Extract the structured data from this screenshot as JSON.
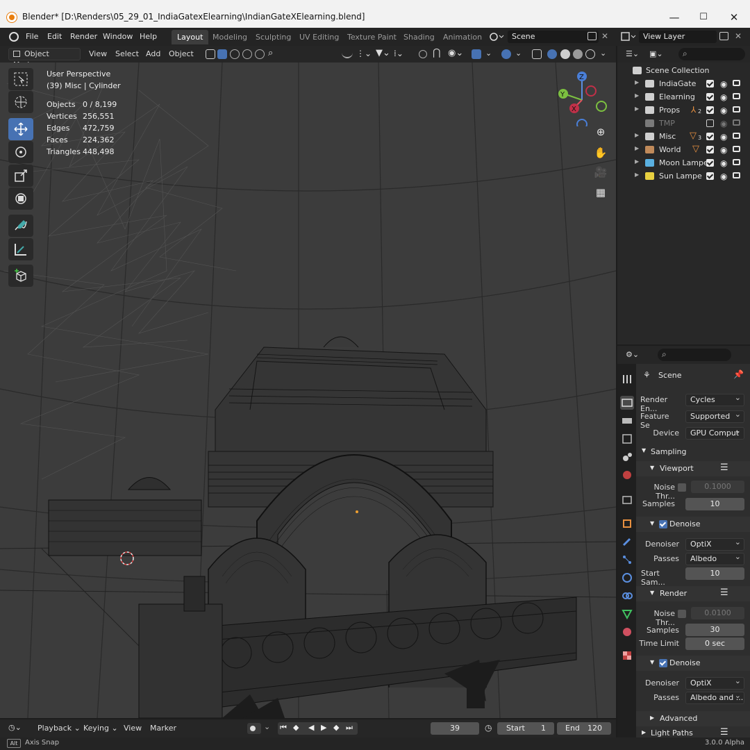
{
  "window": {
    "title": "Blender* [D:\\Renders\\05_29_01_IndiaGatexElearning\\IndianGateXElearning.blend]",
    "minimize": "—",
    "maximize": "☐",
    "close": "✕"
  },
  "menubar": {
    "menus": [
      "File",
      "Edit",
      "Render",
      "Window",
      "Help"
    ],
    "workspaces": [
      "Layout",
      "Modeling",
      "Sculpting",
      "UV Editing",
      "Texture Paint",
      "Shading",
      "Animation"
    ],
    "active_workspace": "Layout",
    "scene_name": "Scene",
    "view_layer": "View Layer"
  },
  "viewport_header": {
    "mode": "Object Mode",
    "view": "View",
    "select": "Select",
    "add": "Add",
    "object": "Object"
  },
  "viewport": {
    "perspective": "User Perspective",
    "context": "(39) Misc | Cylinder",
    "stats": [
      {
        "label": "Objects",
        "value": "0 / 8,199"
      },
      {
        "label": "Vertices",
        "value": "256,551"
      },
      {
        "label": "Edges",
        "value": "472,759"
      },
      {
        "label": "Faces",
        "value": "224,362"
      },
      {
        "label": "Triangles",
        "value": "448,498"
      }
    ],
    "gizmo_axes": [
      "Z",
      "Y",
      "X"
    ]
  },
  "outliner": {
    "root": "Scene Collection",
    "items": [
      {
        "name": "IndiaGate",
        "enabled": true,
        "color": "#cfcfcf"
      },
      {
        "name": "Elearning",
        "enabled": true,
        "color": "#cfcfcf"
      },
      {
        "name": "Props",
        "enabled": true,
        "color": "#cfcfcf",
        "badge": "2"
      },
      {
        "name": "TMP",
        "enabled": false,
        "color": "#8a8a8a"
      },
      {
        "name": "Misc",
        "enabled": true,
        "color": "#cfcfcf",
        "badge": "3"
      },
      {
        "name": "World",
        "enabled": true,
        "color": "#c08a5a"
      },
      {
        "name": "Moon Lampe",
        "enabled": true,
        "color": "#5ab0e0"
      },
      {
        "name": "Sun Lampe",
        "enabled": true,
        "color": "#e8d040"
      }
    ]
  },
  "properties": {
    "context": "Scene",
    "render_engine_label": "Render En...",
    "render_engine": "Cycles",
    "feature_set_label": "Feature Se",
    "feature_set": "Supported",
    "device_label": "Device",
    "device": "GPU Comput",
    "sampling": "Sampling",
    "viewport_panel": {
      "title": "Viewport",
      "noise_label": "Noise Thr...",
      "noise_value": "0.1000",
      "samples_label": "Samples",
      "samples_value": "10",
      "denoise": "Denoise",
      "denoiser_label": "Denoiser",
      "denoiser": "OptiX",
      "passes_label": "Passes",
      "passes": "Albedo",
      "start_label": "Start Sam...",
      "start_value": "10"
    },
    "render_panel": {
      "title": "Render",
      "noise_label": "Noise Thr...",
      "noise_value": "0.0100",
      "samples_label": "Samples",
      "samples_value": "30",
      "time_label": "Time Limit",
      "time_value": "0 sec",
      "denoise": "Denoise",
      "denoiser_label": "Denoiser",
      "denoiser": "OptiX",
      "passes_label": "Passes",
      "passes": "Albedo and ..."
    },
    "advanced": "Advanced",
    "light_paths": "Light Paths"
  },
  "timeline": {
    "playback": "Playback",
    "keying": "Keying",
    "view": "View",
    "marker": "Marker",
    "current_frame": "39",
    "start_label": "Start",
    "start_value": "1",
    "end_label": "End",
    "end_value": "120"
  },
  "statusbar": {
    "key": "Alt",
    "hint": "Axis Snap",
    "version": "3.0.0 Alpha"
  }
}
